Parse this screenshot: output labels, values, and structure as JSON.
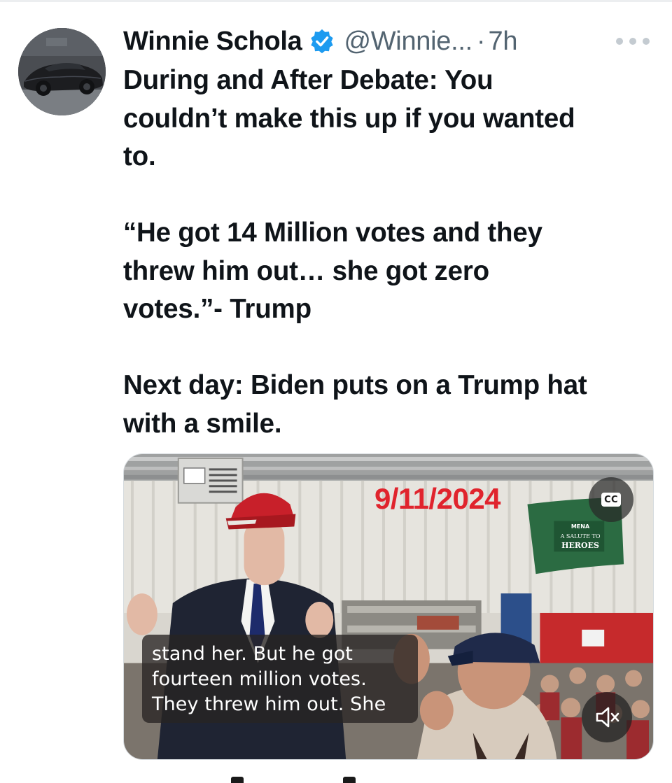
{
  "tweet": {
    "author_name": "Winnie Schola",
    "verified": true,
    "handle": "@Winnie...",
    "separator": "·",
    "time_ago": "7h",
    "text_paragraphs": [
      "During and After Debate: You\ncouldn’t make this up if you wanted\nto.",
      "“He got 14 Million votes and they\nthrew him out… she got zero\nvotes.”- Trump",
      "Next day: Biden puts on a Trump hat\nwith a smile."
    ]
  },
  "media": {
    "date_stamp": "9/11/2024",
    "cc_label": "CC",
    "caption": "stand her. But he got\nfourteen million votes.\nThey threw him out. She",
    "banner_lines": [
      "MENA",
      "A SALUTE TO",
      "HEROES"
    ]
  },
  "icons": {
    "avatar": "sports-car-avatar",
    "verified": "verified-badge-icon",
    "more": "more-options-icon",
    "cc": "closed-captions-icon",
    "mute": "speaker-muted-icon"
  },
  "colors": {
    "accent_blue": "#1d9bf0",
    "text_primary": "#0f1419",
    "text_secondary": "#536471",
    "date_stamp_red": "#e0242d"
  }
}
